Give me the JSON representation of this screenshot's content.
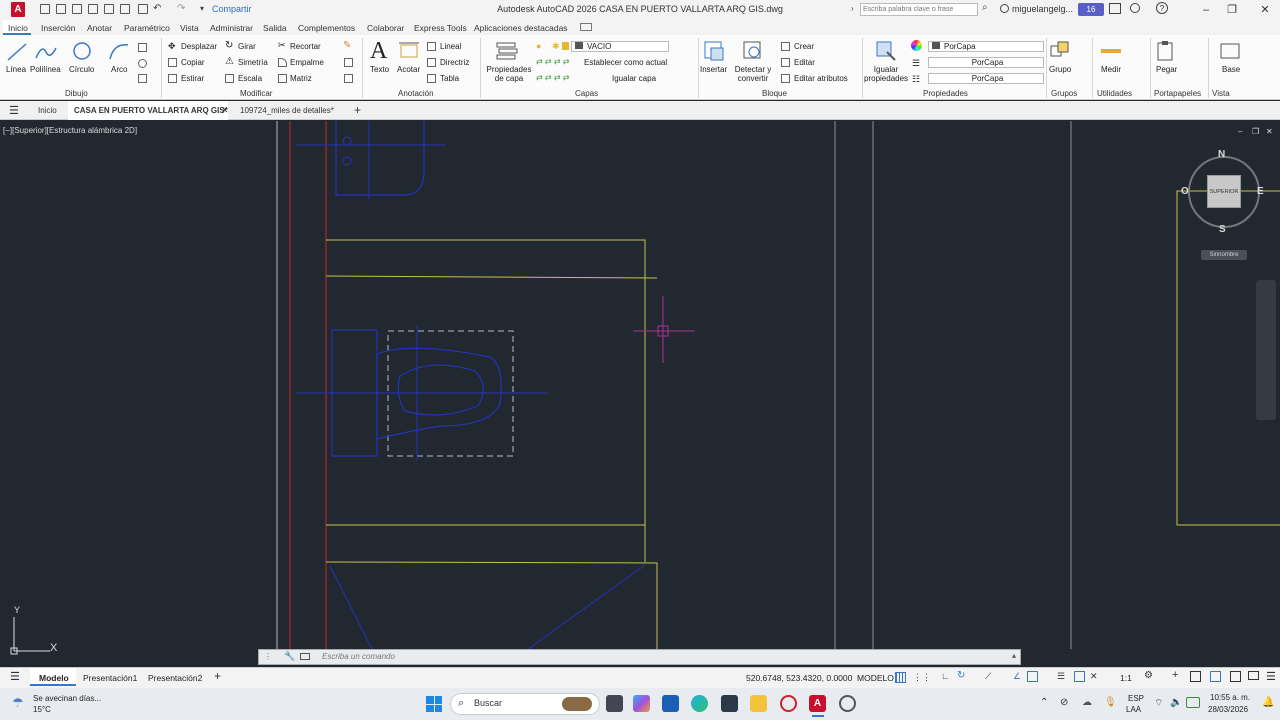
{
  "titlebar": {
    "app_logo": "A",
    "share": "Compartir",
    "title": "Autodesk AutoCAD 2026   CASA EN PUERTO VALLARTA ARQ GIS.dwg",
    "search_placeholder": "Escriba palabra clave o frase",
    "user": "miguelangelg...",
    "notifications": "16"
  },
  "ribbon_tabs": [
    "Inicio",
    "Inserción",
    "Anotar",
    "Paramétrico",
    "Vista",
    "Administrar",
    "Salida",
    "Complementos",
    "Colaborar",
    "Express Tools",
    "Aplicaciones destacadas"
  ],
  "ribbon": {
    "draw": {
      "linea": "Línea",
      "polilinea": "Polilínea",
      "circulo": "Círculo",
      "arco": "Arco",
      "title": "Dibujo"
    },
    "modify": {
      "desplazar": "Desplazar",
      "girar": "Girar",
      "recortar": "Recortar",
      "copiar": "Copiar",
      "simetria": "Simetría",
      "empalme": "Empalme",
      "estirar": "Estirar",
      "escala": "Escala",
      "matriz": "Matriz",
      "title": "Modificar"
    },
    "annotation": {
      "texto": "Texto",
      "acotar": "Acotar",
      "lineal": "Lineal",
      "directriz": "Directriz",
      "tabla": "Tabla",
      "title": "Anotación"
    },
    "layers": {
      "propiedades": "Propiedades de capa",
      "layer_combo": "VACIO",
      "establecer": "Establecer como actual",
      "igualar": "Igualar capa",
      "title": "Capas"
    },
    "block": {
      "insertar": "Insertar",
      "detectar": "Detectar y convertir",
      "crear": "Crear",
      "editar": "Editar",
      "editar_atributos": "Editar atributos",
      "title": "Bloque"
    },
    "properties": {
      "igualar": "Igualar propiedades",
      "color": "PorCapa",
      "linetype": "PorCapa",
      "lineweight": "PorCapa",
      "title": "Propiedades"
    },
    "groups": {
      "grupo": "Grupo",
      "title": "Grupos"
    },
    "utilities": {
      "medir": "Medir",
      "title": "Utilidades"
    },
    "clipboard": {
      "pegar": "Pegar",
      "title": "Portapapeles"
    },
    "view": {
      "base": "Base",
      "title": "Vista"
    }
  },
  "doc_tabs": {
    "home": "Inicio",
    "active": "CASA EN PUERTO VALLARTA ARQ GIS*",
    "other": "109724_miles de detalles*"
  },
  "viewport": {
    "label": "[−][Superior][Estructura alámbrica 2D]",
    "viewcube_top": "SUPERIOR",
    "compass": {
      "n": "N",
      "s": "S",
      "e": "E",
      "w": "O"
    },
    "wcs": "Sinnombre",
    "ucs_x": "X",
    "ucs_y": "Y"
  },
  "command": {
    "placeholder": "Escriba un comando"
  },
  "status": {
    "tabs": [
      "Modelo",
      "Presentación1",
      "Presentación2"
    ],
    "coords": "520.6748, 523.4320, 0.0000",
    "space": "MODELO",
    "scale": "1:1"
  },
  "taskbar": {
    "weather_line1": "Se avecinan días...",
    "weather_line2": "15°C",
    "search": "Buscar",
    "lang1": "ESP",
    "lang2": "LAA",
    "time": "10:55 a. m.",
    "date": "28/03/2026"
  },
  "colors": {
    "accent": "#3a77c4",
    "autocad_red": "#c8102e",
    "canvas": "#212830",
    "yellow_line": "#c8c14a",
    "blue_line": "#2532b8",
    "red_line": "#c42828",
    "cursor": "#b0309a"
  }
}
